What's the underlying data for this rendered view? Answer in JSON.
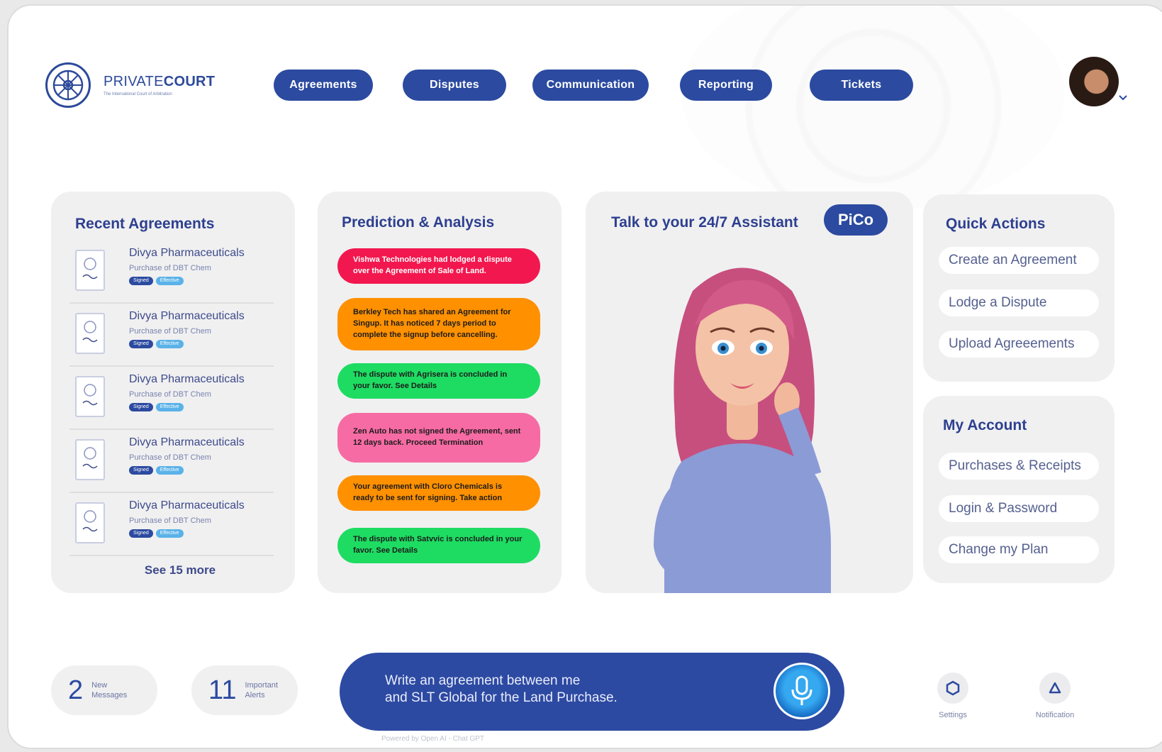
{
  "brand": {
    "name_light": "PRIVATE",
    "name_bold": "COURT",
    "tagline": "The International Court of Arbitration"
  },
  "nav": [
    "Agreements",
    "Disputes",
    "Communication",
    "Reporting",
    "Tickets"
  ],
  "recent_agreements": {
    "title": "Recent Agreements",
    "items": [
      {
        "name": "Divya Pharmaceuticals",
        "sub": "Purchase of DBT Chem",
        "badge1": "Signed",
        "badge2": "Effective"
      },
      {
        "name": "Divya Pharmaceuticals",
        "sub": "Purchase of DBT Chem",
        "badge1": "Signed",
        "badge2": "Effective"
      },
      {
        "name": "Divya Pharmaceuticals",
        "sub": "Purchase of DBT Chem",
        "badge1": "Signed",
        "badge2": "Effective"
      },
      {
        "name": "Divya Pharmaceuticals",
        "sub": "Purchase of DBT Chem",
        "badge1": "Signed",
        "badge2": "Effective"
      },
      {
        "name": "Divya Pharmaceuticals",
        "sub": "Purchase of DBT Chem",
        "badge1": "Signed",
        "badge2": "Effective"
      }
    ],
    "see_more": "See 15 more"
  },
  "prediction": {
    "title": "Prediction & Analysis",
    "items": [
      {
        "text": "Vishwa Technologies had lodged a dispute over the Agreement of Sale of Land.",
        "color": "#f2184f",
        "text_color": "#ffffff"
      },
      {
        "text": "Berkley Tech has shared an Agreement for Singup. It has noticed 7 days period to complete the signup before cancelling.",
        "color": "#ff9000",
        "text_color": "#1c1c1c"
      },
      {
        "text": "The dispute with Agrisera is concluded in your favor. See Details",
        "color": "#1edc62",
        "text_color": "#1c1c1c"
      },
      {
        "text": "Zen Auto has not signed the Agreement, sent 12 days back. Proceed Termination",
        "color": "#f76ba4",
        "text_color": "#1c1c1c"
      },
      {
        "text": "Your agreement with Cloro Chemicals is ready to be sent for signing. Take action",
        "color": "#ff9000",
        "text_color": "#1c1c1c"
      },
      {
        "text": "The dispute with Satvvic is concluded in your favor. See Details",
        "color": "#1edc62",
        "text_color": "#1c1c1c"
      }
    ]
  },
  "assistant": {
    "title": "Talk to your 24/7 Assistant",
    "name": "PiCo"
  },
  "quick_actions": {
    "title": "Quick Actions",
    "items": [
      "Create an Agreement",
      "Lodge a Dispute",
      "Upload Agreeements"
    ]
  },
  "my_account": {
    "title": "My Account",
    "items": [
      "Purchases & Receipts",
      "Login & Password",
      "Change my Plan"
    ]
  },
  "stats": [
    {
      "value": "2",
      "label_line1": "New",
      "label_line2": "Messages"
    },
    {
      "value": "11",
      "label_line1": "Important",
      "label_line2": "Alerts"
    }
  ],
  "prompt": {
    "line1": "Write an agreement between me",
    "line2": "and SLT Global  for the Land Purchase."
  },
  "powered_by": "Powered by Open AI - Chat GPT",
  "utilities": {
    "settings": "Settings",
    "notification": "Notification"
  },
  "colors": {
    "accent": "#2b4aa0",
    "card_bg": "#f0f0f1"
  }
}
